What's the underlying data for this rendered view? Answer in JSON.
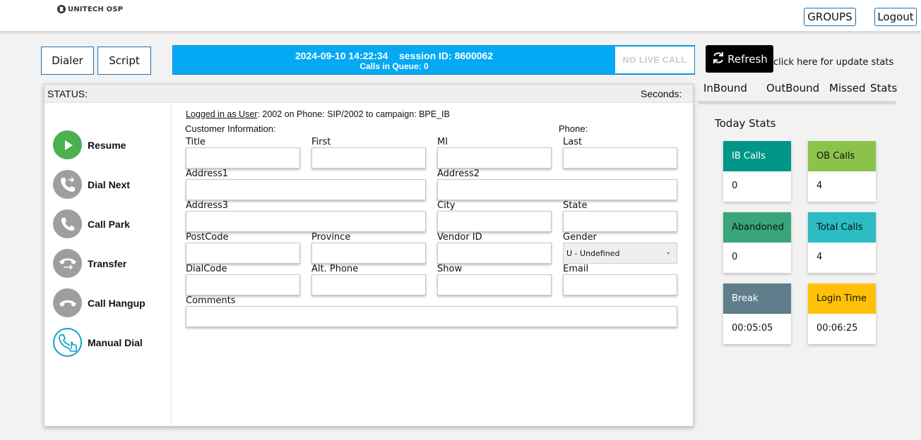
{
  "header": {
    "logo_text": "UNITECH OSP",
    "groups_label": "GROUPS",
    "logout_label": "Logout"
  },
  "nav": {
    "dialer_label": "Dialer",
    "script_label": "Script"
  },
  "session": {
    "datetime": "2024-09-10 14:22:34",
    "session_id_text": "session ID: 8600062",
    "calls_in_queue": "Calls in Queue: 0",
    "live_call": "NO LIVE CALL"
  },
  "status_panel": {
    "status_label": "STATUS:",
    "seconds_label": "Seconds:"
  },
  "actions": [
    {
      "label": "Resume",
      "icon": "play-icon",
      "color": "#4caf50"
    },
    {
      "label": "Dial Next",
      "icon": "phone-dial-next-icon",
      "color": "#9e9e9e"
    },
    {
      "label": "Call Park",
      "icon": "phone-park-icon",
      "color": "#9e9e9e"
    },
    {
      "label": "Transfer",
      "icon": "phone-transfer-icon",
      "color": "#9e9e9e"
    },
    {
      "label": "Call Hangup",
      "icon": "phone-hangup-icon",
      "color": "#9e9e9e"
    },
    {
      "label": "Manual Dial",
      "icon": "manual-dial-icon",
      "color": "#11a3c4"
    }
  ],
  "form": {
    "logged_in_label": "Logged in as User",
    "logged_in_rest": ": 2002 on Phone: SIP/2002  to campaign: BPE_IB",
    "customer_info_label": "Customer Information:",
    "phone_label": "Phone:",
    "fields": {
      "title": "Title",
      "first": "First",
      "mi": "MI",
      "last": "Last",
      "address1": "Address1",
      "address2": "Address2",
      "address3": "Address3",
      "city": "City",
      "state": "State",
      "postcode": "PostCode",
      "province": "Province",
      "vendor_id": "Vendor ID",
      "gender": "Gender",
      "dialcode": "DialCode",
      "alt_phone": "Alt. Phone",
      "show": "Show",
      "email": "Email",
      "comments": "Comments"
    },
    "gender_value": "U - Undefined"
  },
  "stats": {
    "refresh_label": "Refresh",
    "refresh_hint": "click here for update stats",
    "tabs": [
      "InBound",
      "OutBound",
      "Missed",
      "Stats"
    ],
    "today_label": "Today Stats",
    "cards": [
      {
        "label": "IB Calls",
        "value": "0",
        "color": "#009688",
        "text_color": "#ffffff"
      },
      {
        "label": "OB Calls",
        "value": "4",
        "color": "#8bc34a",
        "text_color": "#111111"
      },
      {
        "label": "Abandoned",
        "value": "0",
        "color": "#3aa57a",
        "text_color": "#111111"
      },
      {
        "label": "Total Calls",
        "value": "4",
        "color": "#2bbcc4",
        "text_color": "#111111"
      },
      {
        "label": "Break",
        "value": "00:05:05",
        "color": "#607d8b",
        "text_color": "#ffffff"
      },
      {
        "label": "Login Time",
        "value": "00:06:25",
        "color": "#ffc107",
        "text_color": "#111111"
      }
    ]
  }
}
